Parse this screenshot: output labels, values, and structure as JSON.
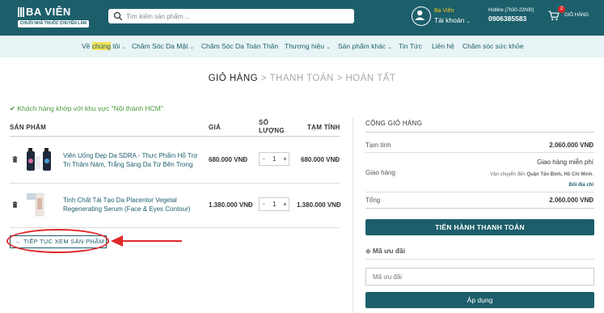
{
  "header": {
    "logo_name": "BA VIÊN",
    "logo_tagline": "CHUỖI NHÀ THUỐC CHUYÊN LÀM ĐẸP",
    "search_placeholder": "Tìm kiếm sản phẩm ...",
    "account_name": "Ba Viên",
    "account_label": "Tài khoản",
    "hotline_label": "Hotline (7h30-22h00)",
    "hotline_number": "0906385583",
    "cart_count": "2",
    "cart_label": "GIỎ HÀNG",
    "brand_color": "#1c5f6b",
    "accent_color": "#f5c518"
  },
  "nav": {
    "items": [
      {
        "pre": "Về ",
        "hl": "chúng",
        "post": " tôi",
        "arrow": true
      },
      {
        "label": "Chăm Sóc Da Mặt",
        "arrow": true
      },
      {
        "label": "Chăm Sóc Da Toàn Thân",
        "arrow": false
      },
      {
        "label": "Thương hiệu",
        "arrow": true
      },
      {
        "label": "Sản phẩm khác",
        "arrow": true
      },
      {
        "label": "Tin Tức",
        "arrow": false
      },
      {
        "label": "Liên hệ",
        "arrow": false
      },
      {
        "label": "Chăm sóc sức khỏe",
        "arrow": false
      }
    ]
  },
  "steps": {
    "current": "GIỎ HÀNG",
    "sep": ">",
    "step2": "THANH TOÁN",
    "step3": "HOÀN TẤT"
  },
  "notice": "Khách hàng khớp với khu vực \"Nội thành HCM\"",
  "cart": {
    "col_product": "SẢN PHẨM",
    "col_price": "GIÁ",
    "col_qty": "SỐ LƯỢNG",
    "col_subtotal": "TẠM TÍNH",
    "items": [
      {
        "name": "Viên Uống Đẹp Da SDRA - Thực Phẩm Hỗ Trợ Trị Thâm Nám, Trắng Sáng Da Từ Bên Trong",
        "price": "680.000 VNĐ",
        "qty": "1",
        "subtotal": "680.000 VNĐ"
      },
      {
        "name": "Tinh Chất Tái Tạo Da Placentor Vegetal Regenerating Serum (Face & Eyes Contour)",
        "price": "1.380.000 VNĐ",
        "qty": "1",
        "subtotal": "1.380.000 VNĐ"
      }
    ],
    "continue_label": "← TIẾP TỤC XEM SẢN PHẨM"
  },
  "summary": {
    "title": "CỘNG GIỎ HÀNG",
    "subtotal_label": "Tạm tính",
    "subtotal_value": "2.060.000 VNĐ",
    "shipping_label": "Giao hàng",
    "shipping_value": "Giao hàng miễn phí",
    "shipping_note_pre": "Vận chuyển đến ",
    "shipping_note_bold": "Quận Tân Bình, Hồ Chí Minh",
    "shipping_note_post": ".",
    "change_address": "Đổi địa chỉ",
    "total_label": "Tổng",
    "total_value": "2.060.000 VNĐ",
    "checkout_button": "TIẾN HÀNH THANH TOÁN",
    "promo_title": "Mã ưu đãi",
    "promo_placeholder": "Mã ưu đãi",
    "apply_button": "Áp dụng"
  }
}
